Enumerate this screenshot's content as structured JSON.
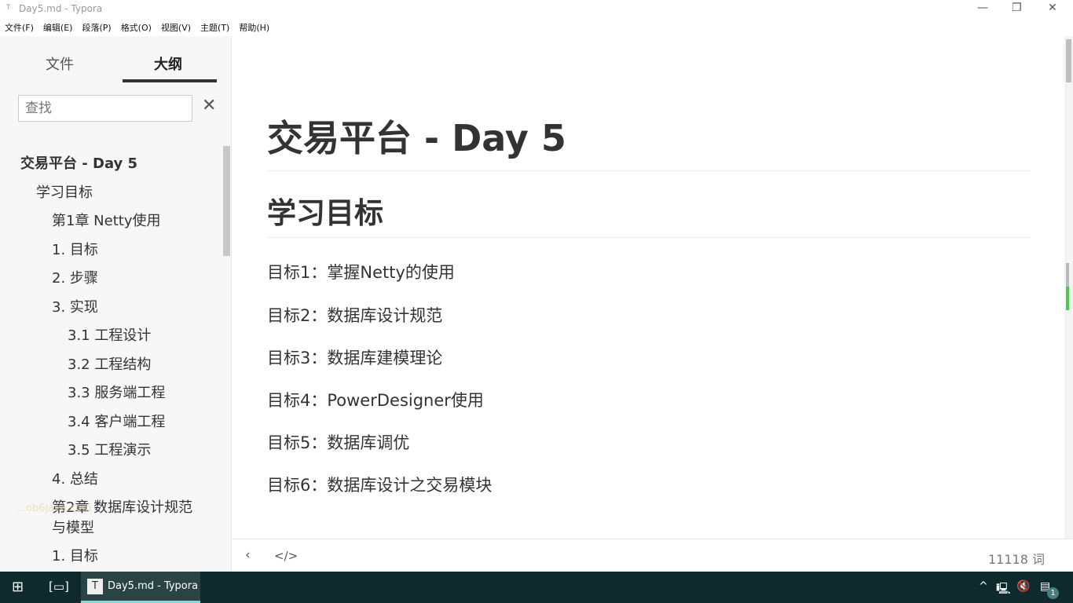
{
  "window": {
    "icon": "T",
    "title": "Day5.md - Typora",
    "controls": {
      "minimize": "—",
      "restore": "❐",
      "close": "✕"
    }
  },
  "menu": [
    "文件(F)",
    "编辑(E)",
    "段落(P)",
    "格式(O)",
    "视图(V)",
    "主题(T)",
    "帮助(H)"
  ],
  "sidebar": {
    "tabs": [
      "文件",
      "大纲"
    ],
    "active_tab": "大纲",
    "search_placeholder": "查找",
    "close": "✕",
    "outline": [
      "交易平台 - Day 5",
      "学习目标",
      "第1章 Netty使用",
      "1. 目标",
      "2. 步骤",
      "3. 实现",
      "3.1 工程设计",
      "3.2 工程结构",
      "3.3 服务端工程",
      "3.4 客户端工程",
      "3.5 工程演示",
      "4. 总结",
      "第2章 数据库设计规范与模型",
      "1. 目标"
    ],
    "watermark": "…ob6java.com"
  },
  "document": {
    "title": "交易平台 - Day 5",
    "h2": "学习目标",
    "goals": [
      "目标1：掌握Netty的使用",
      "目标2：数据库设计规范",
      "目标3：数据库建模理论",
      "目标4：PowerDesigner使用",
      "目标5：数据库调优",
      "目标6：数据库设计之交易模块"
    ]
  },
  "footer": {
    "back": "‹",
    "source": "</>",
    "word_count": "11118 词"
  },
  "taskbar": {
    "app_icon": "T",
    "app_label": "Day5.md - Typora",
    "notifications": "1"
  }
}
